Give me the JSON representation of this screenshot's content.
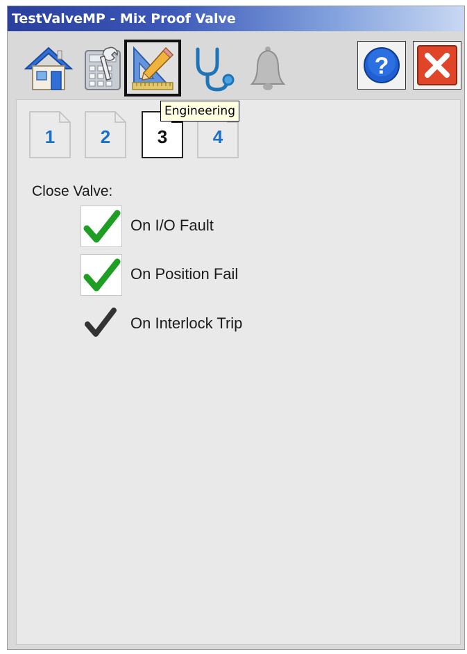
{
  "window": {
    "title": "TestValveMP - Mix Proof Valve"
  },
  "toolbar": {
    "buttons": [
      {
        "name": "home",
        "icon": "home-icon",
        "active": false
      },
      {
        "name": "maintenance",
        "icon": "calculator-wrench-icon",
        "active": false
      },
      {
        "name": "engineering",
        "icon": "ruler-pencil-icon",
        "active": true
      },
      {
        "name": "diagnostics",
        "icon": "stethoscope-icon",
        "active": false
      },
      {
        "name": "alarms",
        "icon": "bell-icon",
        "active": false
      }
    ],
    "help_icon": "help-icon",
    "close_icon": "close-icon",
    "tooltip": "Engineering"
  },
  "pages": {
    "tabs": [
      "1",
      "2",
      "3",
      "4"
    ],
    "active": "3"
  },
  "close_valve": {
    "label": "Close Valve:",
    "options": [
      {
        "label": "On I/O Fault",
        "checked": true,
        "editable": true
      },
      {
        "label": "On Position Fail",
        "checked": true,
        "editable": true
      },
      {
        "label": "On Interlock Trip",
        "checked": true,
        "editable": false
      }
    ]
  },
  "colors": {
    "check_green": "#1e9e22",
    "check_gray": "#333333",
    "tab_blue": "#1a6fc7",
    "close_red": "#e0452a",
    "help_blue": "#1f5fd1"
  }
}
